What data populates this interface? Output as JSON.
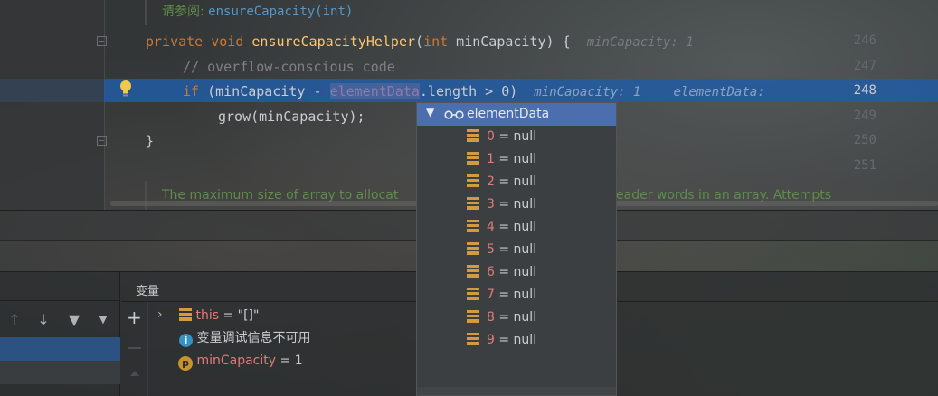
{
  "editor": {
    "doc_see_prefix": "请参阅: ",
    "doc_see_link": "ensureCapacity(int)",
    "line_numbers": [
      "246",
      "247",
      "248",
      "249",
      "250",
      "251"
    ],
    "line246": {
      "kw1": "private",
      "kw2": "void",
      "method": "ensureCapacityHelper",
      "paren_open": "(",
      "kw3": "int",
      "param": " minCapacity) {",
      "hint": "minCapacity: 1"
    },
    "line247": {
      "comment": "// overflow-conscious code"
    },
    "line248": {
      "kw": "if",
      "pre": " (minCapacity - ",
      "field": "elementData",
      "post": ".length > 0)",
      "hint1": "minCapacity: 1",
      "hint2": "elementData:"
    },
    "line249": {
      "code": "grow(minCapacity);"
    },
    "line250": {
      "code": "}"
    },
    "doc_bottom_left": "The maximum size of array to allocat",
    "doc_bottom_right": "eader words in an array. Attempts"
  },
  "variables_panel": {
    "tab_label": "变量",
    "rows": [
      {
        "name": "this",
        "eq": " = ",
        "value": "\"[]\""
      },
      {
        "info": "变量调试信息不可用"
      },
      {
        "name": "minCapacity",
        "eq": " = ",
        "value": "1"
      }
    ]
  },
  "popup": {
    "title": "elementData",
    "items": [
      {
        "index": "0",
        "value": " = null"
      },
      {
        "index": "1",
        "value": " = null"
      },
      {
        "index": "2",
        "value": " = null"
      },
      {
        "index": "3",
        "value": " = null"
      },
      {
        "index": "4",
        "value": " = null"
      },
      {
        "index": "5",
        "value": " = null"
      },
      {
        "index": "6",
        "value": " = null"
      },
      {
        "index": "7",
        "value": " = null"
      },
      {
        "index": "8",
        "value": " = null"
      },
      {
        "index": "9",
        "value": " = null"
      }
    ]
  },
  "icons": {
    "gutter": "lightbulb-icon",
    "popup_header": "watch-glasses-icon",
    "field": "field-icon",
    "info": "info-icon",
    "param": "parameter-icon"
  },
  "colors": {
    "selection": "#225ca4",
    "popup_header": "#4b6eaf",
    "keyword": "#cc7832",
    "method": "#ffc66d",
    "field": "#9876aa",
    "var_name": "#e07b7b"
  }
}
